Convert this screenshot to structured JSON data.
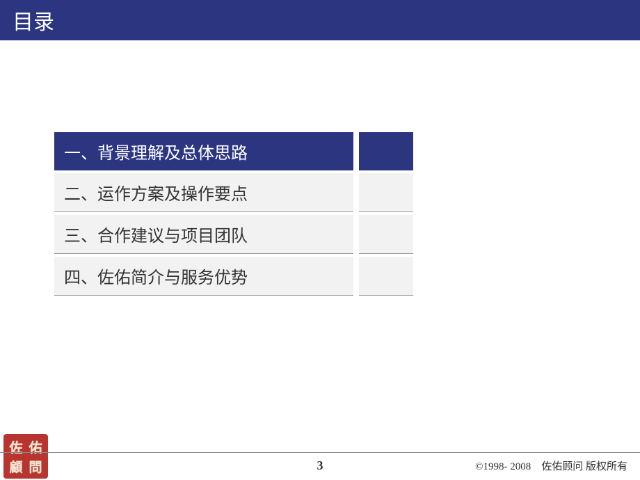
{
  "header": {
    "title": "目录"
  },
  "toc": {
    "items": [
      {
        "label": "一、背景理解及总体思路",
        "active": true
      },
      {
        "label": "二、运作方案及操作要点",
        "active": false
      },
      {
        "label": "三、合作建议与项目团队",
        "active": false
      },
      {
        "label": "四、佐佑简介与服务优势",
        "active": false
      }
    ]
  },
  "seal": {
    "chars": [
      "佐",
      "佑",
      "顧",
      "問"
    ]
  },
  "footer": {
    "page_number": "3",
    "copyright": "©1998- 2008　佐佑顾问 版权所有"
  }
}
